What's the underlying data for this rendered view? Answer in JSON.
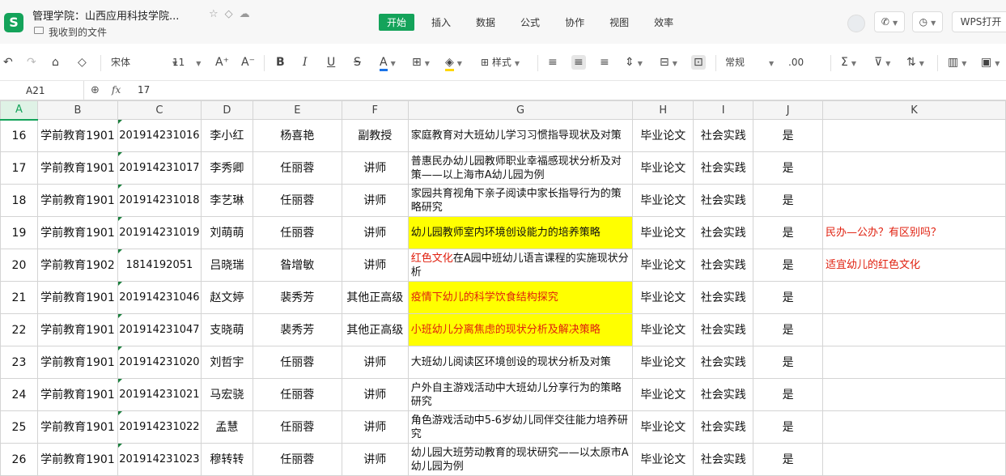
{
  "titlebar": {
    "app_logo": "S",
    "doc_title": "管理学院：山西应用科技学院...",
    "doc_location": "我收到的文件",
    "menu": [
      "开始",
      "插入",
      "数据",
      "公式",
      "协作",
      "视图",
      "效率"
    ],
    "active_menu": "开始",
    "wps_open": "WPS打开",
    "accent_color": "#14a35a"
  },
  "toolbar": {
    "font_name": "宋体",
    "font_size": "11",
    "style_label": "样式",
    "number_format": "常规",
    "icons": [
      "undo-icon",
      "redo-icon",
      "format-painter-icon",
      "clear-format-icon",
      "bold-icon",
      "italic-icon",
      "underline-icon",
      "strikethrough-icon",
      "font-color-icon",
      "border-icon",
      "fill-color-icon",
      "align-left-icon",
      "align-center-icon",
      "align-right-icon",
      "vertical-align-icon",
      "merge-cells-icon",
      "wrap-text-icon",
      "decimal-icon",
      "sum-icon",
      "filter-icon",
      "sort-icon",
      "chart-icon",
      "image-icon"
    ]
  },
  "formula_bar": {
    "cell_ref": "A21",
    "content": "17"
  },
  "columns": [
    "A",
    "B",
    "C",
    "D",
    "E",
    "F",
    "G",
    "H",
    "I",
    "J",
    "K"
  ],
  "rows": [
    {
      "no": "16",
      "major": "学前教育1901",
      "sid": "201914231016",
      "name": "李小红",
      "advisor": "杨喜艳",
      "title": "副教授",
      "topic": "家庭教育对大班幼儿学习习惯指导现状及对策",
      "type": "毕业论文",
      "source": "社会实践",
      "flag": "是",
      "note": ""
    },
    {
      "no": "17",
      "major": "学前教育1901",
      "sid": "201914231017",
      "name": "李秀卿",
      "advisor": "任丽蓉",
      "title": "讲师",
      "topic": "普惠民办幼儿园教师职业幸福感现状分析及对策——以上海市A幼儿园为例",
      "type": "毕业论文",
      "source": "社会实践",
      "flag": "是",
      "note": ""
    },
    {
      "no": "18",
      "major": "学前教育1901",
      "sid": "201914231018",
      "name": "李艺琳",
      "advisor": "任丽蓉",
      "title": "讲师",
      "topic": "家园共育视角下亲子阅读中家长指导行为的策略研究",
      "type": "毕业论文",
      "source": "社会实践",
      "flag": "是",
      "note": ""
    },
    {
      "no": "19",
      "major": "学前教育1901",
      "sid": "201914231019",
      "name": "刘萌萌",
      "advisor": "任丽蓉",
      "title": "讲师",
      "topic": "幼儿园教师室内环境创设能力的培养策略",
      "type": "毕业论文",
      "source": "社会实践",
      "flag": "是",
      "note": "民办—公办？有区别吗？",
      "highlight": true,
      "red": false
    },
    {
      "no": "20",
      "major": "学前教育1902",
      "sid": "1814192051",
      "name": "吕晓瑞",
      "advisor": "昝增敏",
      "title": "讲师",
      "topic_red": "红色文化",
      "topic": "在A园中班幼儿语言课程的实施现状分析",
      "type": "毕业论文",
      "source": "社会实践",
      "flag": "是",
      "note": "适宜幼儿的红色文化"
    },
    {
      "no": "21",
      "major": "学前教育1901",
      "sid": "201914231046",
      "name": "赵文婷",
      "advisor": "裴秀芳",
      "title": "其他正高级",
      "topic": "疫情下幼儿的科学饮食结构探究",
      "type": "毕业论文",
      "source": "社会实践",
      "flag": "是",
      "note": "",
      "highlight": true,
      "red": true
    },
    {
      "no": "22",
      "major": "学前教育1901",
      "sid": "201914231047",
      "name": "支晓萌",
      "advisor": "裴秀芳",
      "title": "其他正高级",
      "topic": "小班幼儿分离焦虑的现状分析及解决策略",
      "type": "毕业论文",
      "source": "社会实践",
      "flag": "是",
      "note": "",
      "highlight": true,
      "red": true
    },
    {
      "no": "23",
      "major": "学前教育1901",
      "sid": "201914231020",
      "name": "刘哲宇",
      "advisor": "任丽蓉",
      "title": "讲师",
      "topic": "大班幼儿阅读区环境创设的现状分析及对策",
      "type": "毕业论文",
      "source": "社会实践",
      "flag": "是",
      "note": ""
    },
    {
      "no": "24",
      "major": "学前教育1901",
      "sid": "201914231021",
      "name": "马宏骁",
      "advisor": "任丽蓉",
      "title": "讲师",
      "topic": "户外自主游戏活动中大班幼儿分享行为的策略研究",
      "type": "毕业论文",
      "source": "社会实践",
      "flag": "是",
      "note": ""
    },
    {
      "no": "25",
      "major": "学前教育1901",
      "sid": "201914231022",
      "name": "孟慧",
      "advisor": "任丽蓉",
      "title": "讲师",
      "topic": "角色游戏活动中5-6岁幼儿同伴交往能力培养研究",
      "type": "毕业论文",
      "source": "社会实践",
      "flag": "是",
      "note": ""
    },
    {
      "no": "26",
      "major": "学前教育1901",
      "sid": "201914231023",
      "name": "穆转转",
      "advisor": "任丽蓉",
      "title": "讲师",
      "topic": "幼儿园大班劳动教育的现状研究——以太原市A幼儿园为例",
      "type": "毕业论文",
      "source": "社会实践",
      "flag": "是",
      "note": ""
    }
  ]
}
